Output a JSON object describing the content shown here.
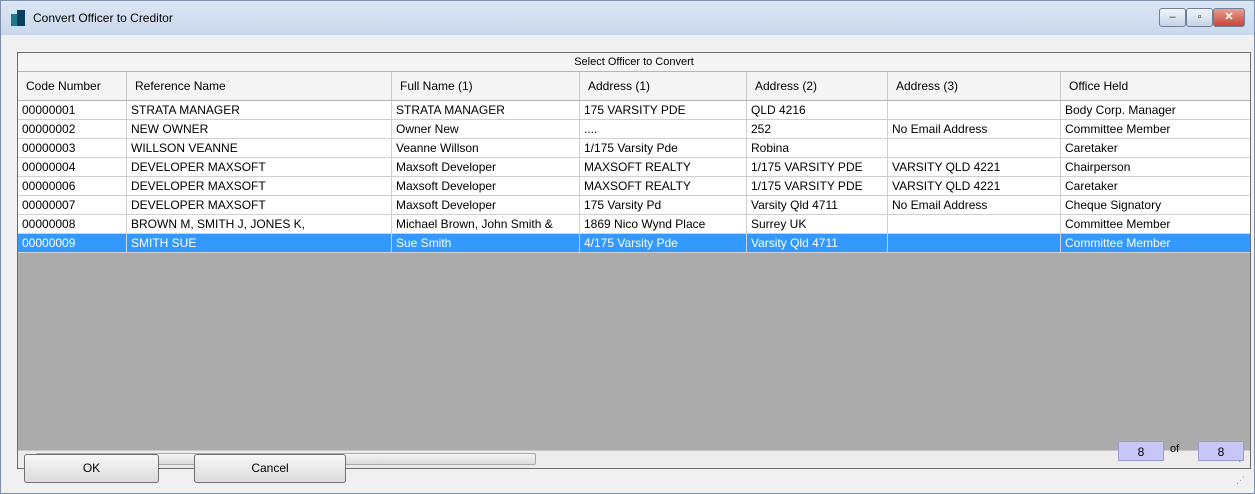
{
  "window": {
    "title": "Convert Officer to Creditor",
    "controls": {
      "minimize": "–",
      "maximize": "▫",
      "close": "✕"
    }
  },
  "grid": {
    "caption": "Select Officer to Convert",
    "columns": [
      "Code Number",
      "Reference Name",
      "Full Name (1)",
      "Address (1)",
      "Address (2)",
      "Address (3)",
      "Office Held"
    ],
    "rows": [
      [
        "00000001",
        "STRATA MANAGER",
        "STRATA MANAGER",
        "175 VARSITY PDE",
        "QLD 4216",
        "",
        "Body Corp. Manager"
      ],
      [
        "00000002",
        "NEW OWNER",
        "Owner New",
        "....",
        "252",
        "No Email Address",
        "Committee Member"
      ],
      [
        "00000003",
        "WILLSON VEANNE",
        "Veanne Willson",
        "1/175 Varsity Pde",
        "Robina",
        "",
        "Caretaker"
      ],
      [
        "00000004",
        "DEVELOPER MAXSOFT",
        "Maxsoft Developer",
        "MAXSOFT REALTY",
        "1/175 VARSITY PDE",
        "VARSITY QLD 4221",
        "Chairperson"
      ],
      [
        "00000006",
        "DEVELOPER MAXSOFT",
        "Maxsoft Developer",
        "MAXSOFT REALTY",
        "1/175 VARSITY PDE",
        "VARSITY QLD 4221",
        "Caretaker"
      ],
      [
        "00000007",
        "DEVELOPER MAXSOFT",
        "Maxsoft Developer",
        "175 Varsity Pd",
        "Varsity Qld 4711",
        "No Email Address",
        "Cheque Signatory"
      ],
      [
        "00000008",
        "BROWN M, SMITH J, JONES K,",
        "Michael Brown, John Smith &",
        "1869 Nico Wynd Place",
        "Surrey UK",
        "",
        "Committee Member"
      ],
      [
        "00000009",
        "SMITH SUE",
        "Sue Smith",
        "4/175 Varsity Pde",
        "Varsity Qld 4711",
        "",
        "Committee Member"
      ]
    ],
    "selected_row_index": 7,
    "scrollbar": {
      "left_arrow": "◂",
      "right_arrow": "▸",
      "thumb_grip": "III"
    }
  },
  "buttons": {
    "ok": "OK",
    "cancel": "Cancel"
  },
  "record_counter": {
    "current": "8",
    "of": "of",
    "total": "8"
  }
}
